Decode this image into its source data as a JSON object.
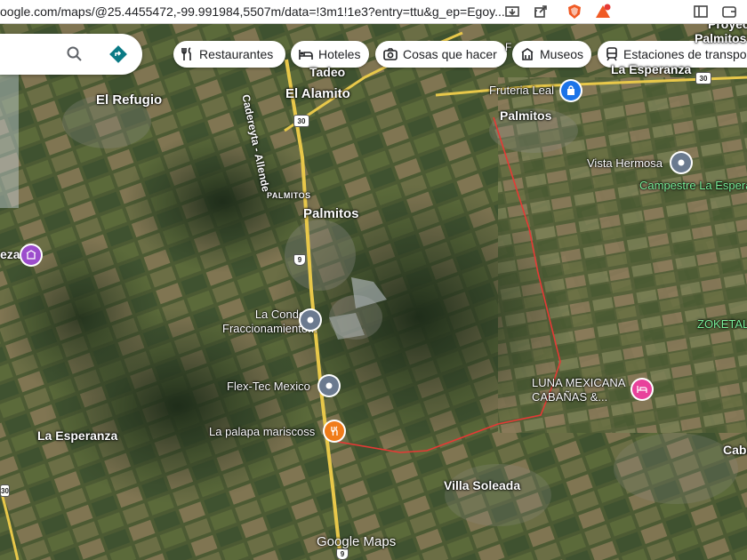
{
  "browser": {
    "url": "oogle.com/maps/@25.4455472,-99.991984,5507m/data=!3m1!1e3?entry=ttu&g_ep=Egoy..."
  },
  "search": {
    "search_icon": "search-icon",
    "directions_icon": "directions-icon"
  },
  "categories": [
    {
      "label": "Restaurantes",
      "icon": "restaurant-icon"
    },
    {
      "label": "Hoteles",
      "icon": "hotel-icon"
    },
    {
      "label": "Cosas que hacer",
      "icon": "camera-icon"
    },
    {
      "label": "Museos",
      "icon": "museum-icon"
    },
    {
      "label": "Estaciones de transpo",
      "icon": "transit-icon"
    }
  ],
  "places": {
    "el_refugio": "El Refugio",
    "el_alamito": "El Alamito",
    "tadeo": "Tadeo",
    "palmitos_main": "Palmitos",
    "palmitos_small": "PALMITOS",
    "palmitos_ne": "Palmitos",
    "la_esperanza_ne": "La Esperanza",
    "la_esperanza_w": "La Esperanza",
    "villa_soleada": "Villa Soleada",
    "proyecto": "Proyec",
    "palmitos_top": "Palmitos",
    "fruteria": "Fruteria Leal",
    "vista_hermosa": "Vista Hermosa",
    "campestre": "Campestre La Espera",
    "zoketal": "ZOKETAL",
    "la_condesa": "La Condesa\nFraccionamiento...",
    "flex_tec": "Flex-Tec Mexico",
    "la_palapa": "La palapa mariscoss",
    "luna_mexicana": "LUNA MEXICANA\nCABAÑAS &...",
    "eza": "eza",
    "caba": "Caba",
    "road_name": "Cadereyta - Allende",
    "f_partial": "F"
  },
  "route_shields": {
    "r30_a": "30",
    "r30_b": "30",
    "r30_c": "30",
    "r9_a": "9",
    "r9_b": "9"
  },
  "watermark": "Google Maps",
  "colors": {
    "road": "#e8c84a",
    "boundary": "#e53935",
    "pin_grey": "#6b7a8f",
    "pin_blue": "#1a73e8",
    "pin_orange": "#f07c1a",
    "pin_pink": "#e8429b",
    "pin_purple": "#9c4dcc"
  }
}
